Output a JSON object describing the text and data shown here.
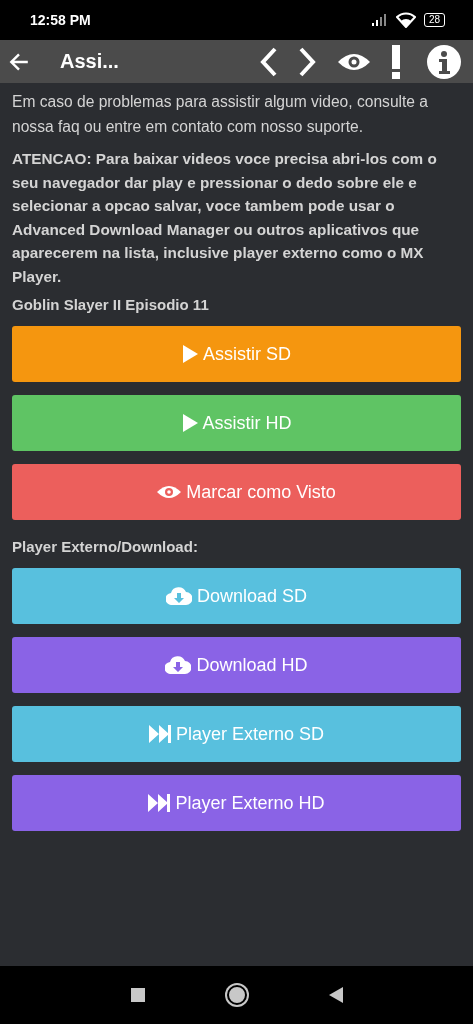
{
  "status_bar": {
    "time": "12:58 PM",
    "battery": "28"
  },
  "toolbar": {
    "title": "Assi..."
  },
  "intro": "Em caso de problemas para assistir algum video, consulte a nossa faq ou entre em contato com nosso suporte.",
  "warning": "ATENCAO: Para baixar videos voce precisa abri-los com o seu navegador dar play e pressionar o dedo sobre ele e selecionar a opcao salvar, voce tambem pode usar o Advanced Download Manager ou outros aplicativos que aparecerem na lista, inclusive player externo como o MX Player.",
  "episode_title": "Goblin Slayer II Episodio 11",
  "watch_buttons": [
    {
      "label": "Assistir SD",
      "kind": "play",
      "color": "#f5960f"
    },
    {
      "label": "Assistir HD",
      "kind": "play",
      "color": "#5fc464"
    },
    {
      "label": "Marcar como Visto",
      "kind": "eye",
      "color": "#ec5f5c"
    }
  ],
  "download_heading": "Player Externo/Download:",
  "download_buttons": [
    {
      "label": "Download SD",
      "kind": "cloud",
      "color": "#58c0de"
    },
    {
      "label": "Download HD",
      "kind": "cloud",
      "color": "#8a63e6"
    },
    {
      "label": "Player Externo SD",
      "kind": "forward",
      "color": "#58c0de"
    },
    {
      "label": "Player Externo HD",
      "kind": "forward",
      "color": "#8a63e6"
    }
  ]
}
